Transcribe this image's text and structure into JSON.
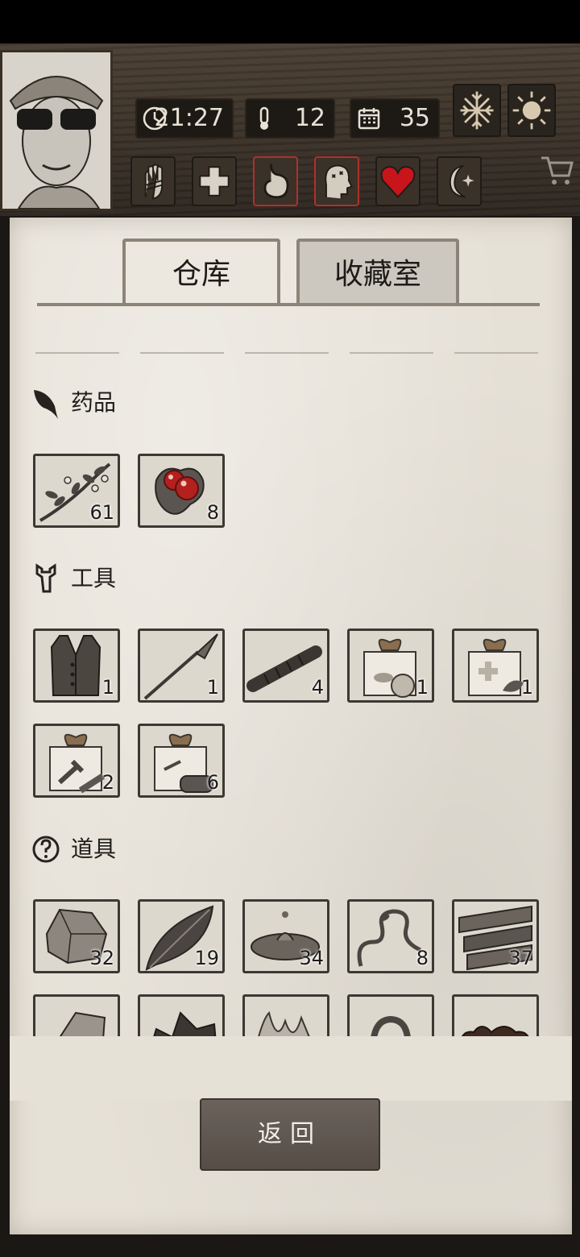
{
  "hud": {
    "time": "21:27",
    "temperature": "12",
    "day": "35",
    "weather_icons": [
      "snowflake-icon",
      "sun-icon"
    ],
    "conditions": [
      {
        "name": "bandage-hand-icon",
        "warning": false
      },
      {
        "name": "medical-cross-icon",
        "warning": false
      },
      {
        "name": "stomach-icon",
        "warning": true
      },
      {
        "name": "head-dizzy-icon",
        "warning": true
      },
      {
        "name": "heart-icon",
        "warning": false
      },
      {
        "name": "moon-sleep-icon",
        "warning": false
      }
    ],
    "shop_icon": "cart-icon"
  },
  "tabs": {
    "active": "仓库",
    "inactive": "收藏室"
  },
  "sections": {
    "medicine": {
      "title": "药品",
      "icon": "leaf-icon",
      "items": [
        {
          "icon": "herb-branch-icon",
          "count": "61"
        },
        {
          "icon": "red-berries-icon",
          "count": "8"
        }
      ]
    },
    "tools": {
      "title": "工具",
      "icon": "wrench-icon",
      "items": [
        {
          "icon": "leather-vest-icon",
          "count": "1"
        },
        {
          "icon": "spear-icon",
          "count": "1"
        },
        {
          "icon": "torch-stick-icon",
          "count": "4"
        },
        {
          "icon": "food-supply-box-icon",
          "count": "1"
        },
        {
          "icon": "medical-supply-box-icon",
          "count": "1"
        },
        {
          "icon": "tool-supply-box-icon",
          "count": "2"
        },
        {
          "icon": "wood-supply-box-icon",
          "count": "6"
        }
      ]
    },
    "props": {
      "title": "道具",
      "icon": "question-circle-icon",
      "items": [
        {
          "icon": "stone-icon",
          "count": "32"
        },
        {
          "icon": "large-leaf-icon",
          "count": "19"
        },
        {
          "icon": "water-puddle-icon",
          "count": "34"
        },
        {
          "icon": "vine-icon",
          "count": "8"
        },
        {
          "icon": "wood-planks-icon",
          "count": "37"
        },
        {
          "icon": "flint-icon",
          "count": ""
        },
        {
          "icon": "coal-icon",
          "count": ""
        },
        {
          "icon": "fiber-icon",
          "count": ""
        },
        {
          "icon": "rope-icon",
          "count": ""
        },
        {
          "icon": "resin-icon",
          "count": ""
        }
      ]
    }
  },
  "back_button": "返回"
}
